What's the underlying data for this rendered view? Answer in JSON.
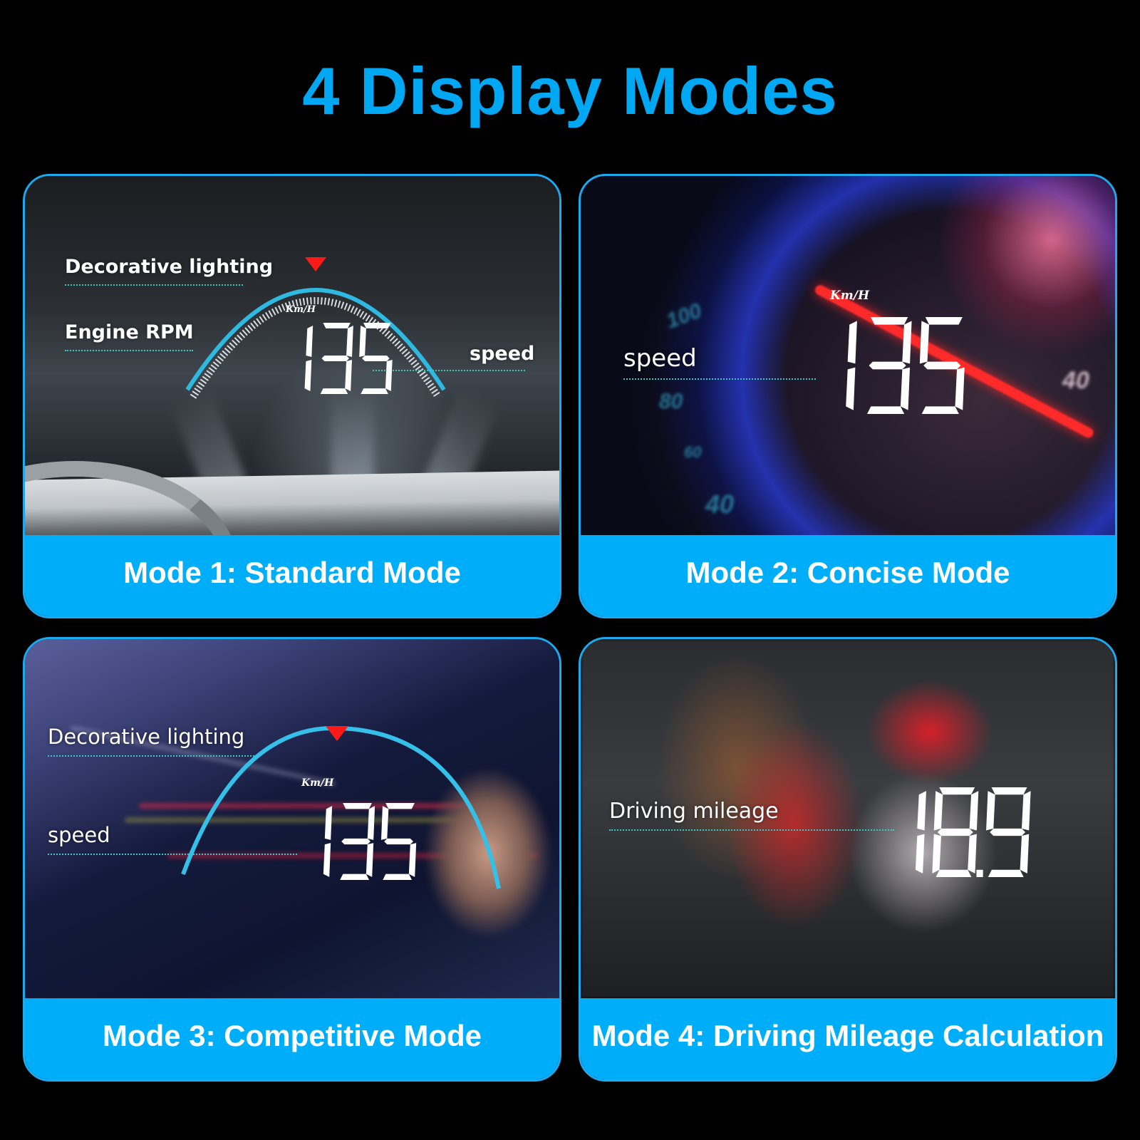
{
  "title": "4 Display Modes",
  "colors": {
    "accent": "#00a8f3",
    "caption_bg": "#00adf8",
    "panel_border": "#1ea9ee",
    "leader_line": "#3ec6c0",
    "arc": "#2fb8e0",
    "marker": "#ff1a1a"
  },
  "panels": [
    {
      "caption": "Mode 1: Standard Mode",
      "labels": {
        "decorative": "Decorative lighting",
        "rpm": "Engine RPM",
        "speed": "speed"
      },
      "unit": "Km/H",
      "readout": "135"
    },
    {
      "caption": "Mode 2: Concise Mode",
      "labels": {
        "speed": "speed"
      },
      "unit": "Km/H",
      "readout": "135",
      "gauge_numbers": [
        "100",
        "80",
        "60",
        "40",
        "40"
      ]
    },
    {
      "caption": "Mode 3: Competitive Mode",
      "labels": {
        "decorative": "Decorative lighting",
        "speed": "speed"
      },
      "unit": "Km/H",
      "readout": "135"
    },
    {
      "caption": "Mode 4: Driving Mileage Calculation",
      "labels": {
        "mileage": "Driving mileage"
      },
      "readout": "18.9"
    }
  ]
}
